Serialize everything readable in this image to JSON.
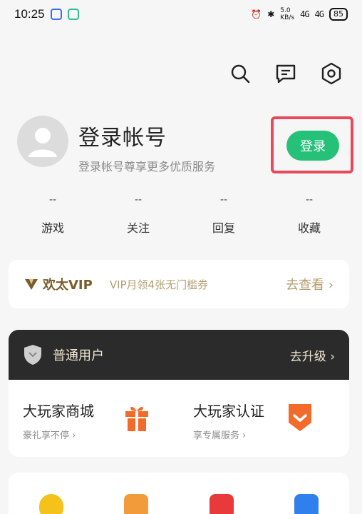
{
  "status_bar": {
    "time": "10:25",
    "net_speed_1": "5.0",
    "net_speed_2": "KB/s",
    "signal_1": "4G",
    "signal_2": "4G",
    "battery": "85"
  },
  "toolbar": {
    "icons": [
      "search-icon",
      "message-icon",
      "settings-icon"
    ]
  },
  "profile": {
    "name": "登录帐号",
    "subtitle": "登录帐号尊享更多优质服务",
    "login_label": "登录"
  },
  "stats": [
    {
      "value": "--",
      "label": "游戏"
    },
    {
      "value": "--",
      "label": "关注"
    },
    {
      "value": "--",
      "label": "回复"
    },
    {
      "value": "--",
      "label": "收藏"
    }
  ],
  "vip": {
    "name": "欢太VIP",
    "description": "VIP月领4张无门槛券",
    "link_label": "去查看",
    "chevron": "›"
  },
  "membership": {
    "title": "普通用户",
    "link_label": "去升级",
    "chevron": "›"
  },
  "features": [
    {
      "title": "大玩家商城",
      "subtitle": "豪礼享不停 ›"
    },
    {
      "title": "大玩家认证",
      "subtitle": "享专属服务 ›"
    }
  ],
  "colors": {
    "accent_green": "#26c178",
    "highlight_red": "#e84a5a",
    "vip_gold": "#b49e71",
    "member_bg": "#2b2b2b",
    "feature_orange": "#f26b2a"
  }
}
